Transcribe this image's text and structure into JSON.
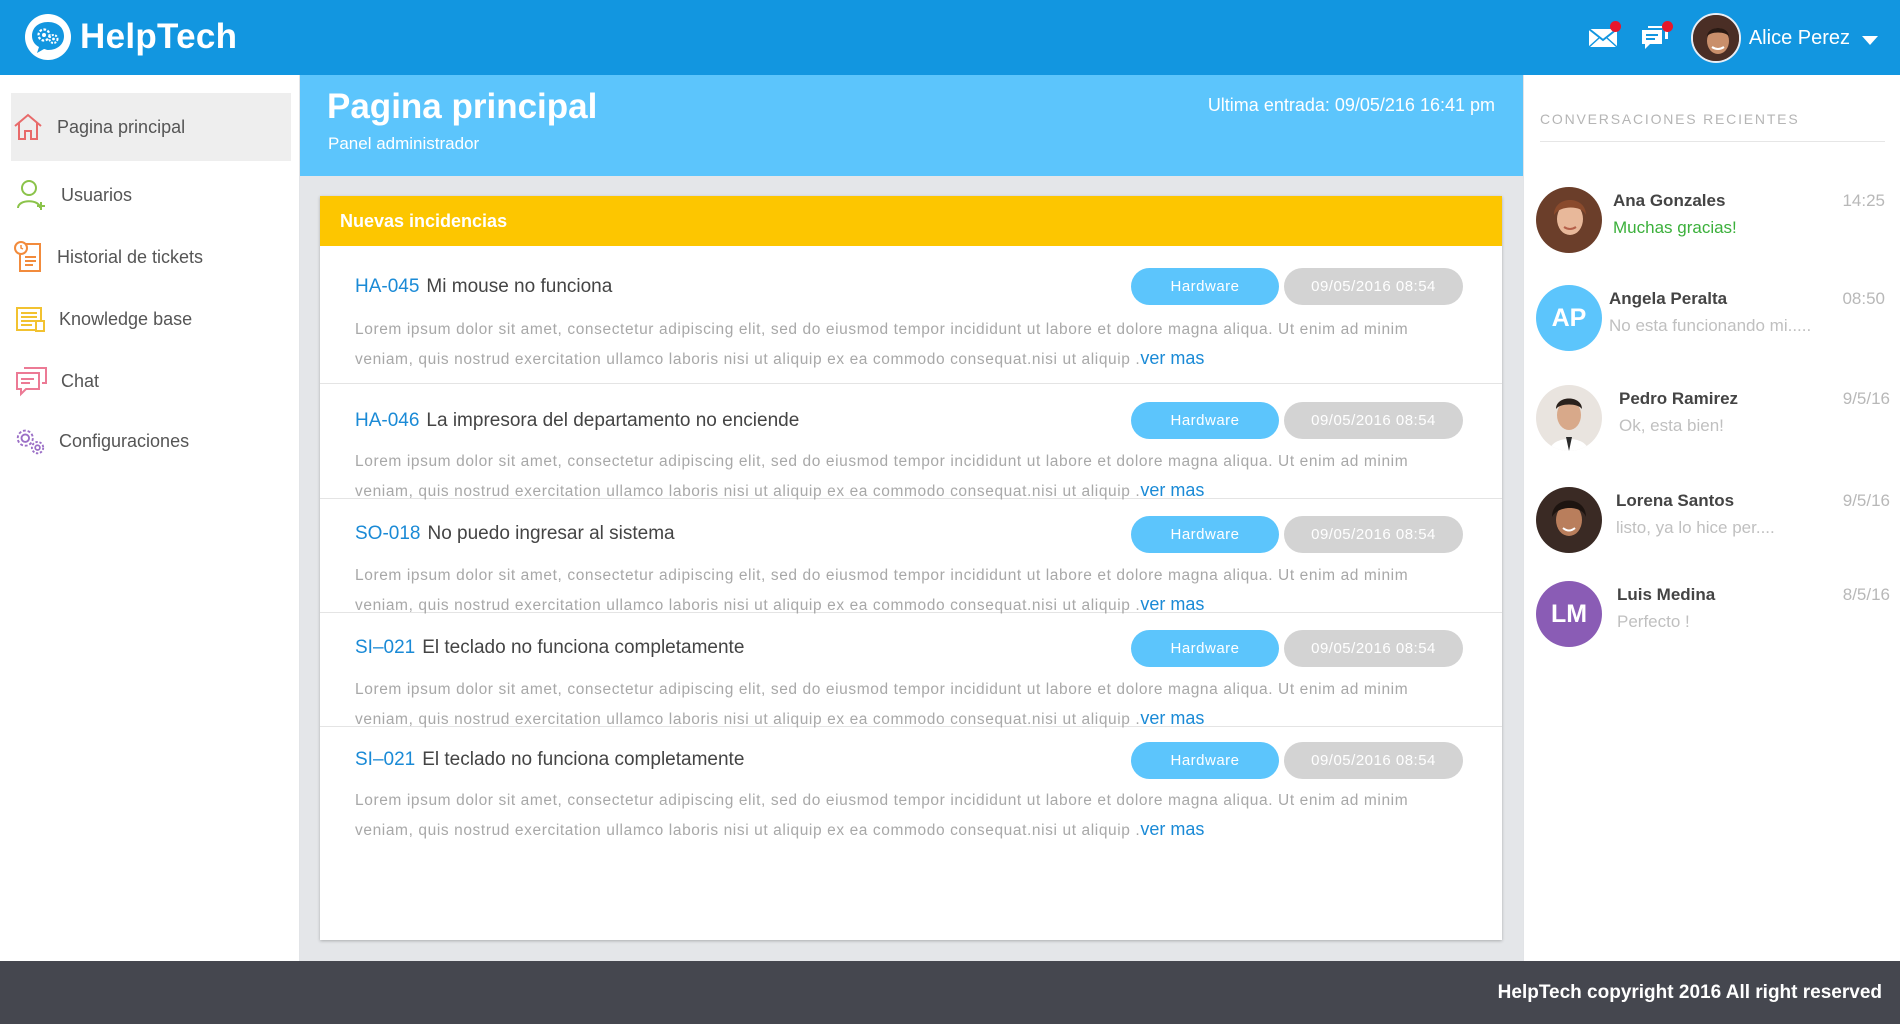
{
  "app": {
    "name": "HelpTech"
  },
  "topbar": {
    "user_name": "Alice Perez",
    "icons": [
      "mail-icon",
      "chat-notification-icon"
    ],
    "brand_color": "#1296e0",
    "notification_color": "#e8172b"
  },
  "sidebar": {
    "items": [
      {
        "label": "Pagina principal",
        "icon": "home-icon",
        "active": true
      },
      {
        "label": "Usuarios",
        "icon": "add-user-icon"
      },
      {
        "label": "Historial de tickets",
        "icon": "ticket-history-icon"
      },
      {
        "label": "Knowledge base",
        "icon": "knowledge-base-icon"
      },
      {
        "label": "Chat",
        "icon": "chat-icon"
      },
      {
        "label": "Configuraciones",
        "icon": "gears-icon"
      }
    ]
  },
  "header": {
    "title": "Pagina principal",
    "subtitle": "Panel administrador",
    "last_login": "Ultima entrada: 09/05/216  16:41 pm",
    "color": "#5cc5fc"
  },
  "panel": {
    "title": "Nuevas incidencias",
    "header_color": "#fdc600",
    "tickets": [
      {
        "code": "HA-045",
        "title": "Mi mouse no funciona",
        "category": "Hardware",
        "datetime": "09/05/2016  08:54",
        "description": "Lorem ipsum dolor sit amet, consectetur adipiscing elit, sed do eiusmod tempor incididunt ut labore et dolore magna aliqua. Ut enim ad minim veniam, quis nostrud exercitation ullamco laboris nisi ut aliquip ex ea commodo consequat.nisi ut aliquip .",
        "more": "ver mas"
      },
      {
        "code": "HA-046",
        "title": "La impresora del departamento no enciende",
        "category": "Hardware",
        "datetime": "09/05/2016  08:54",
        "description": "Lorem ipsum dolor sit amet, consectetur adipiscing elit, sed do eiusmod tempor incididunt ut labore et dolore magna aliqua. Ut enim ad minim veniam, quis nostrud exercitation ullamco laboris nisi ut aliquip ex ea commodo consequat.nisi ut aliquip .",
        "more": "ver mas"
      },
      {
        "code": "SO-018",
        "title": "No puedo ingresar al sistema",
        "category": "Hardware",
        "datetime": "09/05/2016  08:54",
        "description": "Lorem ipsum dolor sit amet, consectetur adipiscing elit, sed do eiusmod tempor incididunt ut labore et dolore magna aliqua. Ut enim ad minim veniam, quis nostrud exercitation ullamco laboris nisi ut aliquip ex ea commodo consequat.nisi ut aliquip .",
        "more": "ver mas"
      },
      {
        "code": "SI–021",
        "title": "El teclado no funciona completamente",
        "category": "Hardware",
        "datetime": "09/05/2016  08:54",
        "description": "Lorem ipsum dolor sit amet, consectetur adipiscing elit, sed do eiusmod tempor incididunt ut labore et dolore magna aliqua. Ut enim ad minim veniam, quis nostrud exercitation ullamco laboris nisi ut aliquip ex ea commodo consequat.nisi ut aliquip .",
        "more": "ver mas"
      },
      {
        "code": "SI–021",
        "title": "El teclado no funciona completamente",
        "category": "Hardware",
        "datetime": "09/05/2016  08:54",
        "description": "Lorem ipsum dolor sit amet, consectetur adipiscing elit, sed do eiusmod tempor incididunt ut labore et dolore magna aliqua. Ut enim ad minim veniam, quis nostrud exercitation ullamco laboris nisi ut aliquip ex ea commodo consequat.nisi ut aliquip .",
        "more": "ver mas"
      }
    ]
  },
  "conversations": {
    "title": "CONVERSACIONES RECIENTES",
    "items": [
      {
        "name": "Ana Gonzales",
        "message": "Muchas gracias!",
        "time": "14:25",
        "initials": "",
        "avatar_color": "#7a4a35",
        "message_color": "#3bb03b"
      },
      {
        "name": "Angela Peralta",
        "message": "No esta funcionando mi.....",
        "time": "08:50",
        "initials": "AP",
        "avatar_color": "#5cc5fc"
      },
      {
        "name": "Pedro Ramirez",
        "message": "Ok, esta bien!",
        "time": "9/5/16",
        "initials": "",
        "avatar_color": "#d9d2cc"
      },
      {
        "name": "Lorena Santos",
        "message": "listo, ya lo hice per....",
        "time": "9/5/16",
        "initials": "",
        "avatar_color": "#3a2a24"
      },
      {
        "name": "Luis Medina",
        "message": "Perfecto !",
        "time": "8/5/16",
        "initials": "LM",
        "avatar_color": "#8a5cb5"
      }
    ]
  },
  "footer": {
    "text": "HelpTech copyright 2016 All right reserved"
  }
}
